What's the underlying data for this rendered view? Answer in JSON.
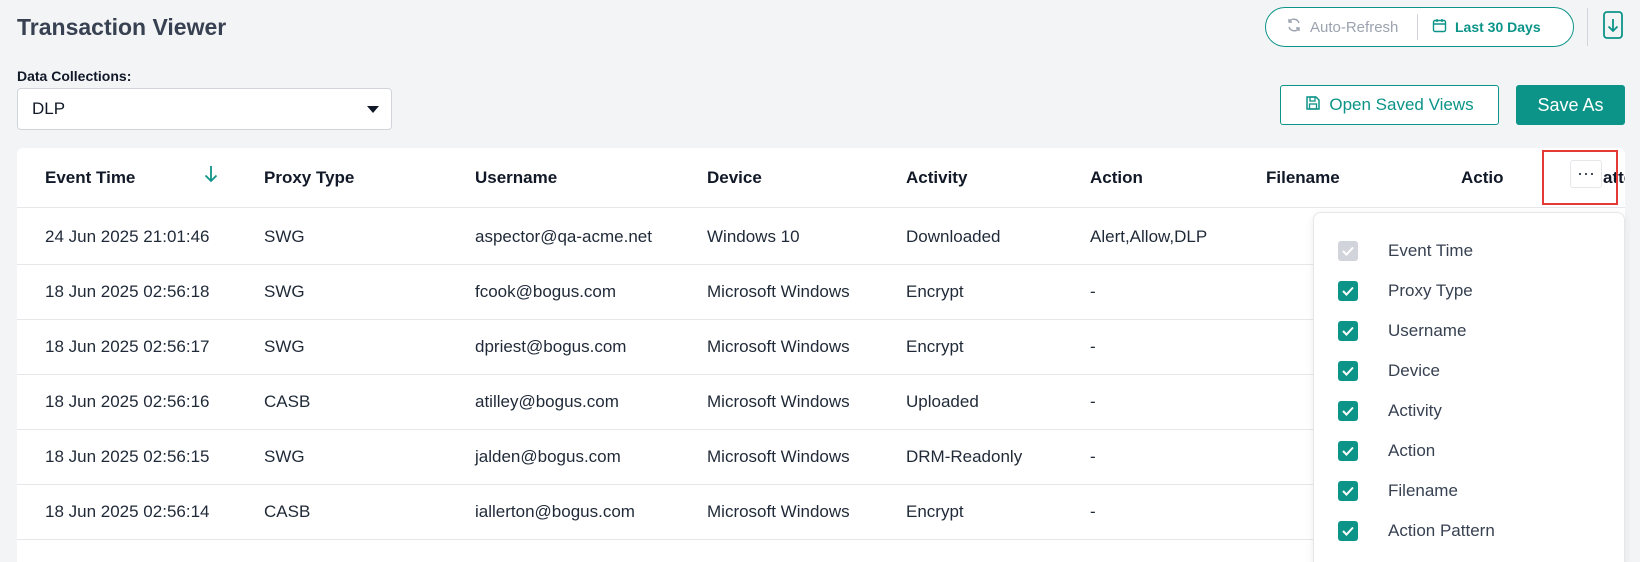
{
  "header": {
    "title": "Transaction Viewer",
    "auto_refresh": "Auto-Refresh",
    "date_range": "Last 30 Days"
  },
  "data_collections": {
    "label": "Data Collections:",
    "selected": "DLP"
  },
  "actions": {
    "open_saved_views": "Open Saved Views",
    "save_as": "Save As"
  },
  "table": {
    "columns": [
      "Event Time",
      "Proxy Type",
      "Username",
      "Device",
      "Activity",
      "Action",
      "Filename",
      "Action Pattern"
    ],
    "visible_last_header": "Actio",
    "visible_last_header_tail": "atte",
    "rows": [
      [
        "24 Jun 2025 21:01:46",
        "SWG",
        "aspector@qa-acme.net",
        "Windows 10",
        "Downloaded",
        "Alert,Allow,DLP"
      ],
      [
        "18 Jun 2025 02:56:18",
        "SWG",
        "fcook@bogus.com",
        "Microsoft Windows",
        "Encrypt",
        "-"
      ],
      [
        "18 Jun 2025 02:56:17",
        "SWG",
        "dpriest@bogus.com",
        "Microsoft Windows",
        "Encrypt",
        "-"
      ],
      [
        "18 Jun 2025 02:56:16",
        "CASB",
        "atilley@bogus.com",
        "Microsoft Windows",
        "Uploaded",
        "-"
      ],
      [
        "18 Jun 2025 02:56:15",
        "SWG",
        "jalden@bogus.com",
        "Microsoft Windows",
        "DRM-Readonly",
        "-"
      ],
      [
        "18 Jun 2025 02:56:14",
        "CASB",
        "iallerton@bogus.com",
        "Microsoft Windows",
        "Encrypt",
        "-"
      ]
    ]
  },
  "column_chooser": {
    "more_glyph": "⋯",
    "items": [
      {
        "label": "Event Time",
        "checked": true,
        "disabled": true
      },
      {
        "label": "Proxy Type",
        "checked": true,
        "disabled": false
      },
      {
        "label": "Username",
        "checked": true,
        "disabled": false
      },
      {
        "label": "Device",
        "checked": true,
        "disabled": false
      },
      {
        "label": "Activity",
        "checked": true,
        "disabled": false
      },
      {
        "label": "Action",
        "checked": true,
        "disabled": false
      },
      {
        "label": "Filename",
        "checked": true,
        "disabled": false
      },
      {
        "label": "Action Pattern",
        "checked": true,
        "disabled": false
      }
    ]
  },
  "colors": {
    "accent": "#0d9488",
    "highlight": "#e53935"
  },
  "icons": {
    "refresh": "refresh-icon",
    "calendar": "calendar-icon",
    "export": "export-icon",
    "save": "save-icon",
    "sort": "arrow-down-icon",
    "check": "check-icon"
  }
}
